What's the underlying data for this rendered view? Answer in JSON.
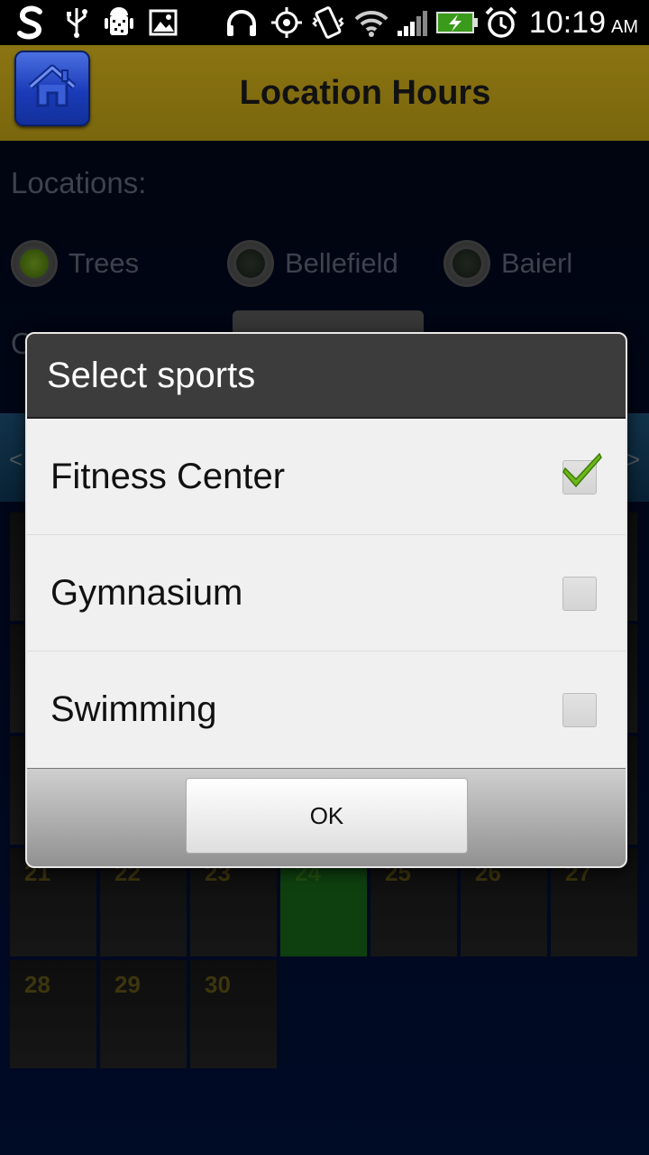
{
  "status_bar": {
    "time": "10:19",
    "ampm": "AM",
    "icons": [
      "s-app-icon",
      "usb-icon",
      "android-debug-icon",
      "image-icon",
      "headphones-icon",
      "gps-icon",
      "vibrate-icon",
      "wifi-icon",
      "signal-icon",
      "battery-charging-icon",
      "alarm-icon"
    ]
  },
  "header": {
    "title": "Location Hours",
    "home_icon": "home-icon"
  },
  "locations": {
    "label": "Locations:",
    "options": [
      {
        "label": "Trees",
        "selected": true
      },
      {
        "label": "Bellefield",
        "selected": false
      },
      {
        "label": "Baierl",
        "selected": false
      }
    ]
  },
  "sports_row": {
    "label": "O"
  },
  "month_nav": {
    "prev": "<",
    "next": ">"
  },
  "calendar": {
    "visible_days": [
      "21",
      "22",
      "23",
      "24",
      "25",
      "26",
      "27",
      "28",
      "29",
      "30"
    ],
    "today": "24"
  },
  "dialog": {
    "title": "Select sports",
    "items": [
      {
        "label": "Fitness Center",
        "checked": true
      },
      {
        "label": "Gymnasium",
        "checked": false
      },
      {
        "label": "Swimming",
        "checked": false
      }
    ],
    "ok_label": "OK"
  },
  "colors": {
    "header_bg": "#7a660d",
    "home_button": "#1a3bb8",
    "today_cell": "#166318",
    "day_number": "#5e5216",
    "dialog_title_bg": "#3c3c3c",
    "check_green": "#6bb81a"
  }
}
